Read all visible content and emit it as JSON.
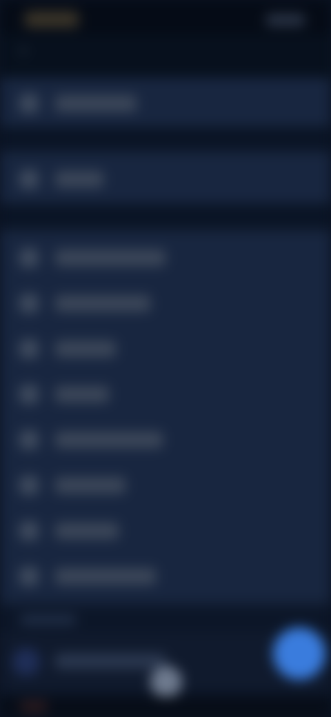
{
  "colors": {
    "background": "#0b1322",
    "list_background": "#182640",
    "accent": "#3a7cdd"
  },
  "header": {
    "title": "",
    "back_icon": "arrow-left-icon"
  },
  "groups": [
    {
      "items": [
        {
          "label": "",
          "icon": "settings-icon"
        }
      ]
    },
    {
      "items": [
        {
          "label": "",
          "icon": "settings-icon"
        }
      ]
    },
    {
      "items": [
        {
          "label": "",
          "icon": "settings-icon"
        },
        {
          "label": "",
          "icon": "settings-icon"
        },
        {
          "label": "",
          "icon": "settings-icon"
        },
        {
          "label": "",
          "icon": "settings-icon"
        },
        {
          "label": "",
          "icon": "settings-icon"
        },
        {
          "label": "",
          "icon": "settings-icon"
        },
        {
          "label": "",
          "icon": "settings-icon"
        },
        {
          "label": "",
          "icon": "settings-icon"
        }
      ]
    }
  ],
  "footer": {
    "section_label": "",
    "row_label": "",
    "fab_icon": "floating-action-icon"
  }
}
